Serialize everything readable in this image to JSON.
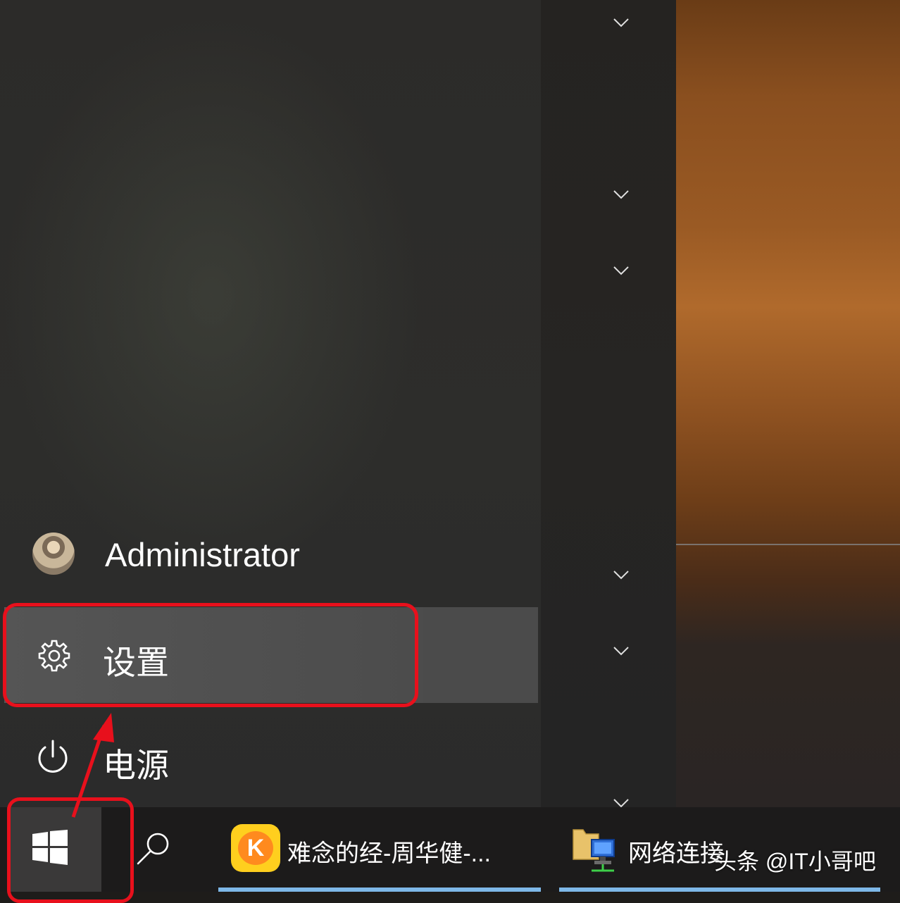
{
  "start_menu": {
    "user": {
      "name": "Administrator",
      "avatar_icon": "user-avatar"
    },
    "settings": {
      "label": "设置",
      "icon": "gear-icon"
    },
    "power": {
      "label": "电源",
      "icon": "power-icon"
    }
  },
  "app_list": {
    "chevron_icon": "chevron-down-icon",
    "group_count_visible": 6
  },
  "taskbar": {
    "start_icon": "windows-logo-icon",
    "search_icon": "search-icon",
    "items": [
      {
        "label": "难念的经-周华健-...",
        "icon": "kugou-music-icon",
        "icon_letter": "K"
      },
      {
        "label": "网络连接",
        "icon": "network-connections-icon"
      }
    ]
  },
  "annotations": {
    "highlight_color": "#e8101c"
  },
  "watermark": "头条 @IT小哥吧",
  "colors": {
    "menu_bg": "#2c2b29",
    "selected_row": "#4b4b4b",
    "taskbar_bg": "#1c1b1b",
    "active_underline": "#7eb8e8"
  }
}
